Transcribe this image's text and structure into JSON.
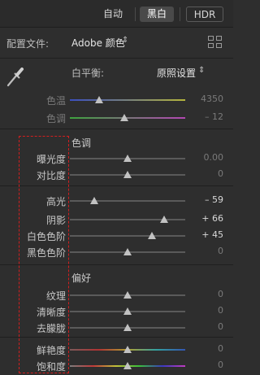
{
  "mode": {
    "auto_label": "自动",
    "bw_label": "黑白",
    "hdr_label": "HDR"
  },
  "profile": {
    "label": "配置文件:",
    "value": "Adobe 颜色",
    "caret": "⇕",
    "grid_icon": "grid-icon"
  },
  "white_balance": {
    "label": "白平衡:",
    "value": "原照设置",
    "caret": "⇕",
    "icon": "eyedropper-icon"
  },
  "wb_sliders": [
    {
      "label": "色温",
      "value": "4350",
      "level": 0.25,
      "dim": true
    },
    {
      "label": "色调",
      "value": "– 12",
      "level": 0.47,
      "dim": true
    }
  ],
  "tone": {
    "title": "色调",
    "sliders_basic": [
      {
        "label": "曝光度",
        "value": "0.00",
        "level": 0.5
      },
      {
        "label": "对比度",
        "value": "0",
        "level": 0.5
      }
    ],
    "sliders_range": [
      {
        "label": "高光",
        "value": "– 59",
        "level": 0.21
      },
      {
        "label": "阴影",
        "value": "+ 66",
        "level": 0.82
      },
      {
        "label": "白色色阶",
        "value": "+ 45",
        "level": 0.71
      },
      {
        "label": "黑色色阶",
        "value": "0",
        "level": 0.5
      }
    ]
  },
  "presence": {
    "title": "偏好",
    "sliders_detail": [
      {
        "label": "纹理",
        "value": "0",
        "level": 0.5
      },
      {
        "label": "清晰度",
        "value": "0",
        "level": 0.5
      },
      {
        "label": "去朦胧",
        "value": "0",
        "level": 0.5
      }
    ],
    "sliders_color": [
      {
        "label": "鲜艳度",
        "value": "0",
        "level": 0.5
      },
      {
        "label": "饱和度",
        "value": "0",
        "level": 0.5
      }
    ]
  }
}
